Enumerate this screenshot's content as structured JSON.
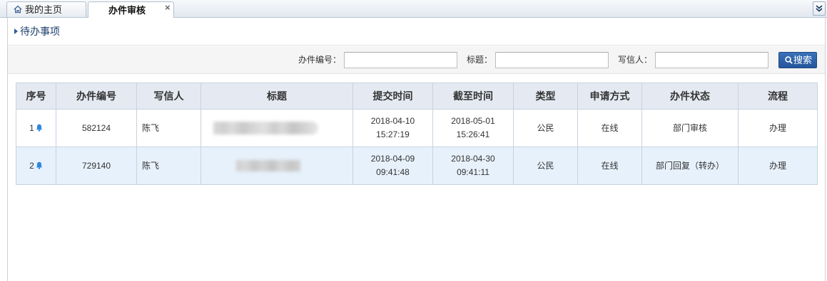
{
  "tabs": {
    "home": {
      "label": "我的主页",
      "icon": "home-icon"
    },
    "active": {
      "label": "办件审核",
      "close_glyph": "×"
    },
    "menu_icon": "double-chevron-down-icon"
  },
  "panel": {
    "title": "待办事项",
    "title_icon": "caret-right-icon"
  },
  "search": {
    "fields": [
      {
        "label": "办件编号：",
        "value": ""
      },
      {
        "label": "标题：",
        "value": ""
      },
      {
        "label": "写信人：",
        "value": ""
      }
    ],
    "button": {
      "label": "搜索",
      "icon": "search-icon"
    }
  },
  "table": {
    "columns": [
      "序号",
      "办件编号",
      "写信人",
      "标题",
      "提交时间",
      "截至时间",
      "类型",
      "申请方式",
      "办件状态",
      "流程"
    ],
    "rows": [
      {
        "index": "1",
        "icon": "bell-icon",
        "case_no": "582124",
        "writer": "陈飞",
        "submitted": {
          "date": "2018-04-10",
          "time": "15:27:19"
        },
        "deadline": {
          "date": "2018-05-01",
          "time": "15:26:41"
        },
        "type": "公民",
        "method": "在线",
        "status": "部门审核",
        "action": "办理"
      },
      {
        "index": "2",
        "icon": "bell-icon",
        "case_no": "729140",
        "writer": "陈飞",
        "submitted": {
          "date": "2018-04-09",
          "time": "09:41:48"
        },
        "deadline": {
          "date": "2018-04-30",
          "time": "09:41:11"
        },
        "type": "公民",
        "method": "在线",
        "status": "部门回复（转办）",
        "action": "办理"
      }
    ]
  },
  "colors": {
    "accent": "#24569b",
    "title_text": "#1f3f6e",
    "header_bg": "#e5eaf2",
    "alt_row_bg": "#e7f1fb",
    "bell": "#2d86e0",
    "border": "#c8d2df"
  }
}
